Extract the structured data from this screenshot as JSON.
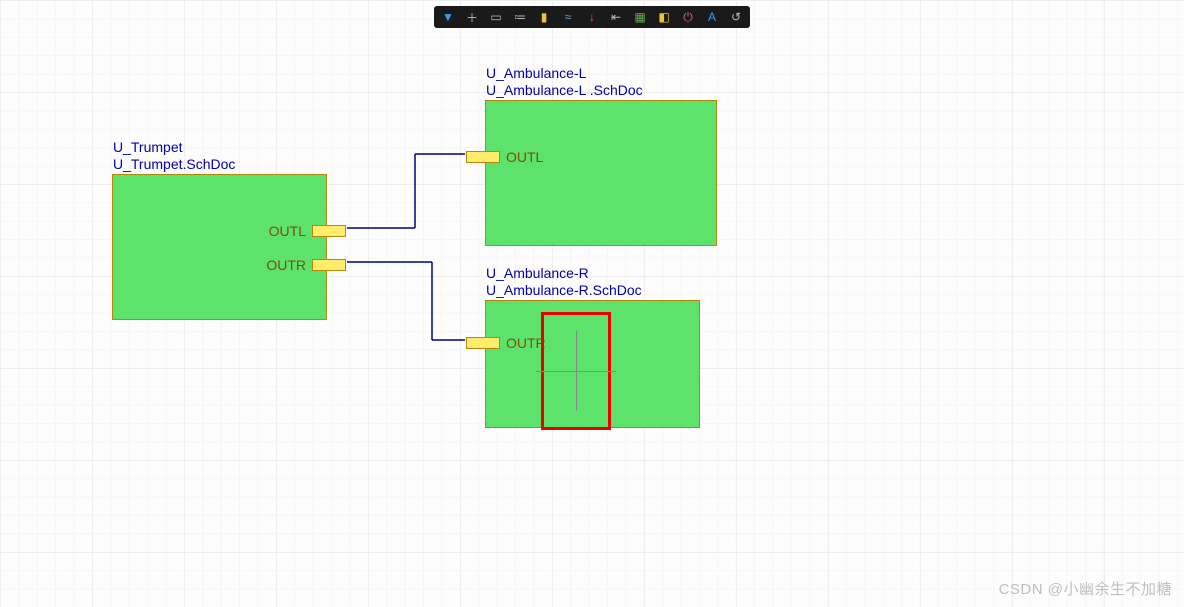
{
  "colors": {
    "sheet_fill": "#5de36b",
    "sheet_border": "#b8860b",
    "port_fill": "#ffec6a",
    "label_color": "#0000aa",
    "wire_color": "#000080",
    "selection_color": "#ee0000"
  },
  "toolbar": {
    "buttons": [
      "pointer-icon",
      "crosshair-icon",
      "rectangle-icon",
      "align-icon",
      "component-icon",
      "net-icon",
      "pin-icon",
      "wire-icon",
      "sheet-icon",
      "tag-icon",
      "power-icon",
      "text-icon",
      "undo-icon"
    ]
  },
  "sheets": {
    "trumpet": {
      "designator": "U_Trumpet",
      "filename": "U_Trumpet.SchDoc",
      "ports": {
        "outl": "OUTL",
        "outr": "OUTR"
      }
    },
    "ambL": {
      "designator": "U_Ambulance-L",
      "filename": "U_Ambulance-L .SchDoc",
      "ports": {
        "outl": "OUTL"
      }
    },
    "ambR": {
      "designator": "U_Ambulance-R",
      "filename": "U_Ambulance-R.SchDoc",
      "ports": {
        "outr": "OUTR"
      }
    }
  },
  "watermark": "CSDN @小幽余生不加糖"
}
